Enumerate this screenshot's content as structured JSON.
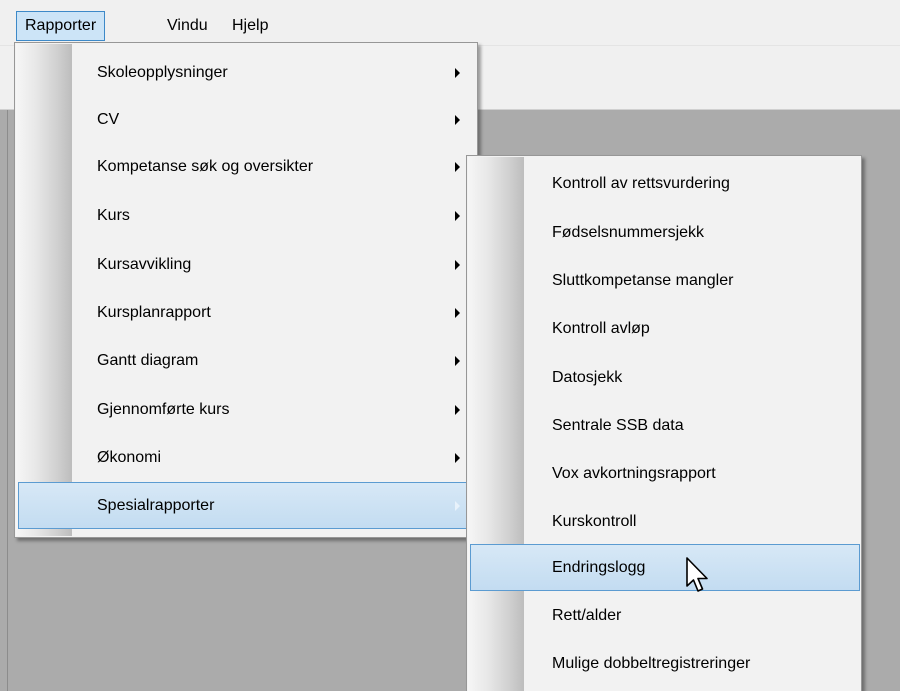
{
  "menubar": {
    "items": [
      {
        "label": "Rapporter",
        "active": true
      },
      {
        "label": "Vindu",
        "active": false
      },
      {
        "label": "Hjelp",
        "active": false
      }
    ]
  },
  "rapporter_menu": {
    "items": [
      {
        "label": "Skoleopplysninger",
        "has_submenu": true
      },
      {
        "label": "CV",
        "has_submenu": true
      },
      {
        "label": "Kompetanse søk og oversikter",
        "has_submenu": true
      },
      {
        "label": "Kurs",
        "has_submenu": true
      },
      {
        "label": "Kursavvikling",
        "has_submenu": true
      },
      {
        "label": "Kursplanrapport",
        "has_submenu": true
      },
      {
        "label": "Gantt diagram",
        "has_submenu": true
      },
      {
        "label": "Gjennomførte kurs",
        "has_submenu": true
      },
      {
        "label": "Økonomi",
        "has_submenu": true
      },
      {
        "label": "Spesialrapporter",
        "has_submenu": true,
        "highlighted": true
      }
    ]
  },
  "spesialrapporter_submenu": {
    "items": [
      {
        "label": "Kontroll av rettsvurdering"
      },
      {
        "label": "Fødselsnummersjekk"
      },
      {
        "label": "Sluttkompetanse mangler"
      },
      {
        "label": "Kontroll avløp"
      },
      {
        "label": "Datosjekk"
      },
      {
        "label": "Sentrale SSB data"
      },
      {
        "label": "Vox avkortningsrapport"
      },
      {
        "label": "Kurskontroll"
      },
      {
        "label": "Endringslogg",
        "highlighted": true
      },
      {
        "label": "Rett/alder"
      },
      {
        "label": "Mulige dobbeltregistreringer"
      }
    ]
  },
  "colors": {
    "menubar_bg": "#f0f0f0",
    "workspace_bg": "#ababab",
    "menu_bg": "#f2f2f2",
    "highlight_bg": "#cce4f7",
    "highlight_border": "#5b9bd1"
  },
  "icons": {
    "submenu_arrow": "chevron-right-icon",
    "pointer": "mouse-pointer-icon"
  }
}
